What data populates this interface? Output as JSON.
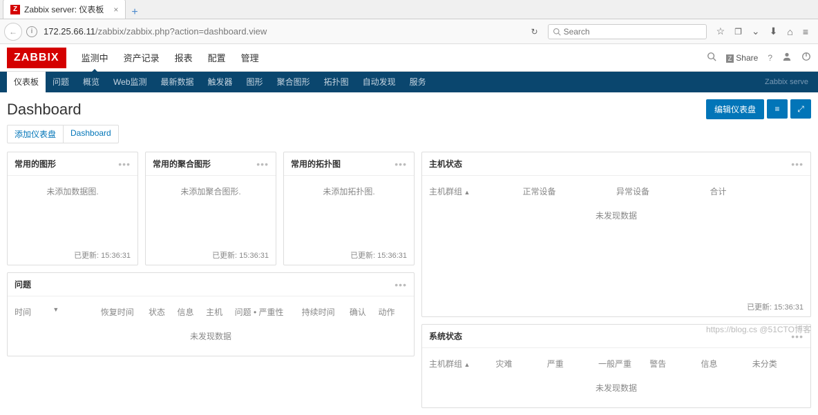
{
  "browser": {
    "tab_title": "Zabbix server: 仪表板",
    "favicon_letter": "Z",
    "url_prefix": "172.25.66.11",
    "url_path": "/zabbix/zabbix.php?action=dashboard.view",
    "search_placeholder": "Search"
  },
  "header": {
    "logo": "ZABBIX",
    "nav": [
      "监测中",
      "资产记录",
      "报表",
      "配置",
      "管理"
    ],
    "share": "Share",
    "question": "?"
  },
  "subnav": {
    "items": [
      "仪表板",
      "问题",
      "概览",
      "Web监测",
      "最新数据",
      "触发器",
      "图形",
      "聚合图形",
      "拓扑图",
      "自动发现",
      "服务"
    ],
    "right": "Zabbix serve"
  },
  "page": {
    "title": "Dashboard",
    "edit_btn": "编辑仪表盘",
    "breadcrumb": [
      "添加仪表盘",
      "Dashboard"
    ]
  },
  "widgets": {
    "graphs": {
      "title": "常用的图形",
      "empty": "未添加数据图.",
      "updated": "已更新: 15:36:31"
    },
    "screens": {
      "title": "常用的聚合图形",
      "empty": "未添加聚合图形.",
      "updated": "已更新: 15:36:31"
    },
    "maps": {
      "title": "常用的拓扑图",
      "empty": "未添加拓扑图.",
      "updated": "已更新: 15:36:31"
    },
    "host_status": {
      "title": "主机状态",
      "cols": [
        "主机群组",
        "正常设备",
        "异常设备",
        "合计"
      ],
      "nodata": "未发现数据",
      "updated": "已更新: 15:36:31"
    },
    "problems": {
      "title": "问题",
      "cols": [
        "时间",
        "恢复时间",
        "状态",
        "信息",
        "主机",
        "问题 • 严重性",
        "持续时间",
        "确认",
        "动作"
      ],
      "nodata": "未发现数据"
    },
    "system_status": {
      "title": "系统状态",
      "cols": [
        "主机群组",
        "灾难",
        "严重",
        "一般严重",
        "警告",
        "信息",
        "未分类"
      ],
      "nodata": "未发现数据"
    }
  },
  "watermark": "https://blog.cs @51CTO博客"
}
